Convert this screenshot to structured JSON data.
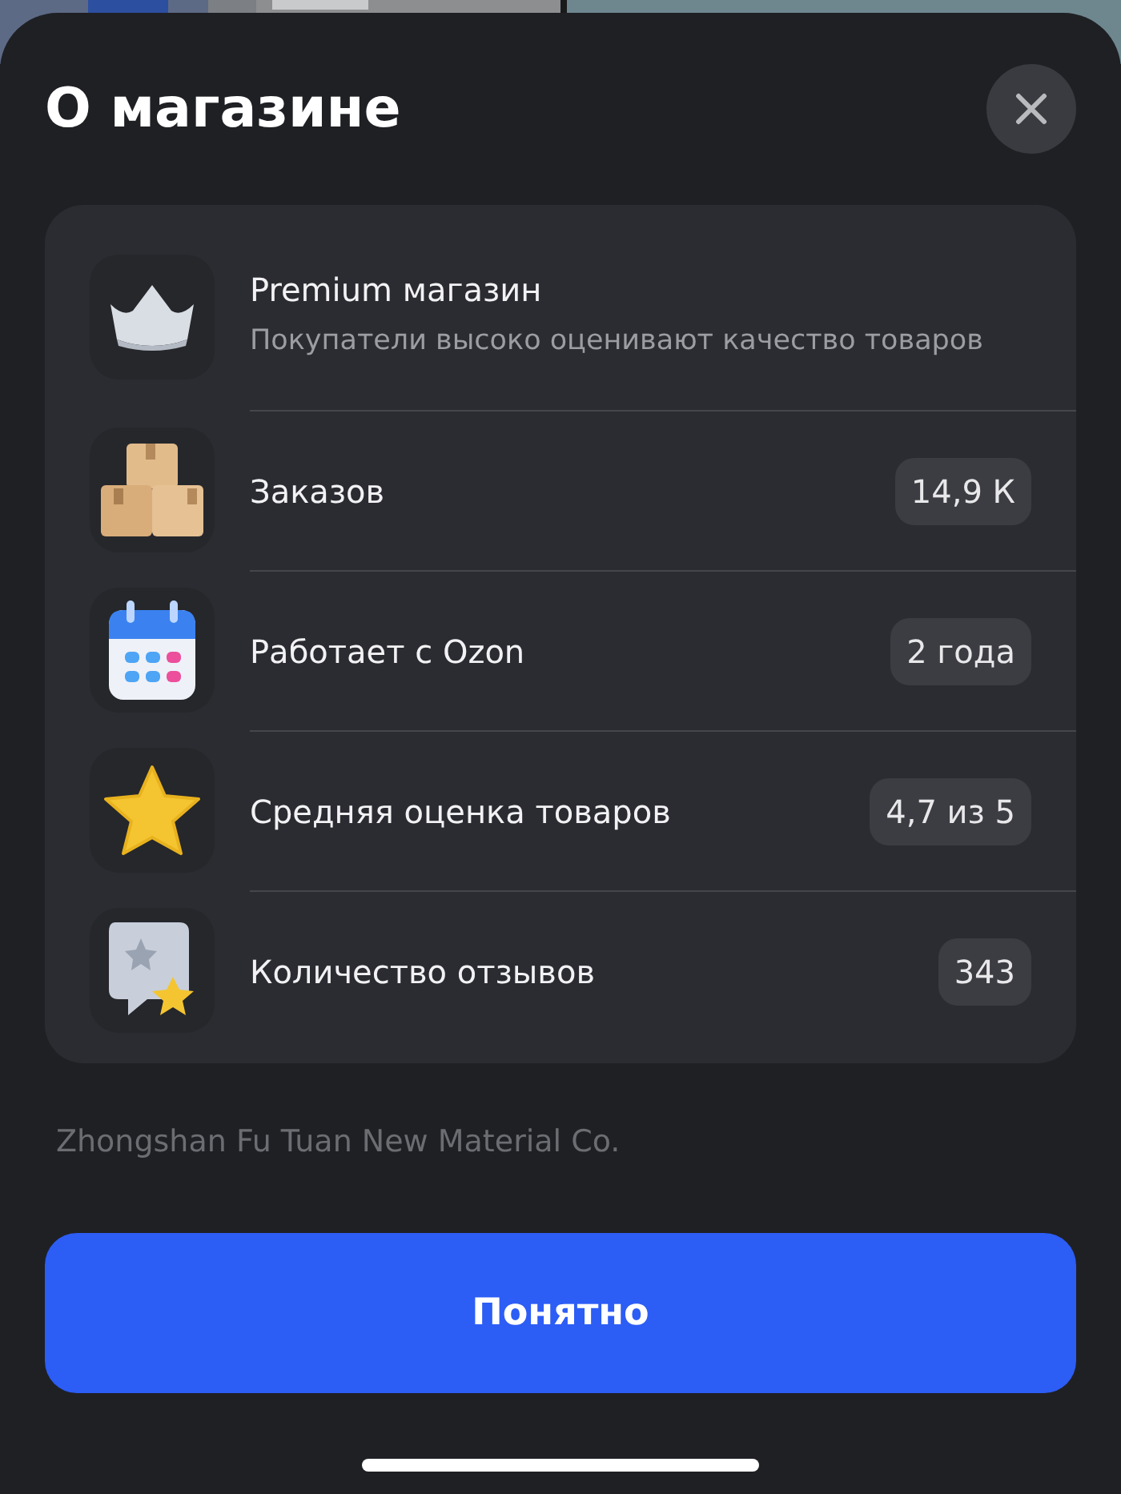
{
  "sheet": {
    "title": "О магазине"
  },
  "stats": [
    {
      "kind": "feature",
      "title": "Premium магазин",
      "description": "Покупатели высоко оценивают качество товаров"
    },
    {
      "kind": "stat",
      "label": "Заказов",
      "value": "14,9 К"
    },
    {
      "kind": "stat",
      "label": "Работает с Ozon",
      "value": "2 года"
    },
    {
      "kind": "stat",
      "label": "Средняя оценка товаров",
      "value": "4,7 из 5"
    },
    {
      "kind": "stat",
      "label": "Количество отзывов",
      "value": "343"
    }
  ],
  "company": "Zhongshan Fu Tuan New Material Co.",
  "confirm_button": "Понятно"
}
